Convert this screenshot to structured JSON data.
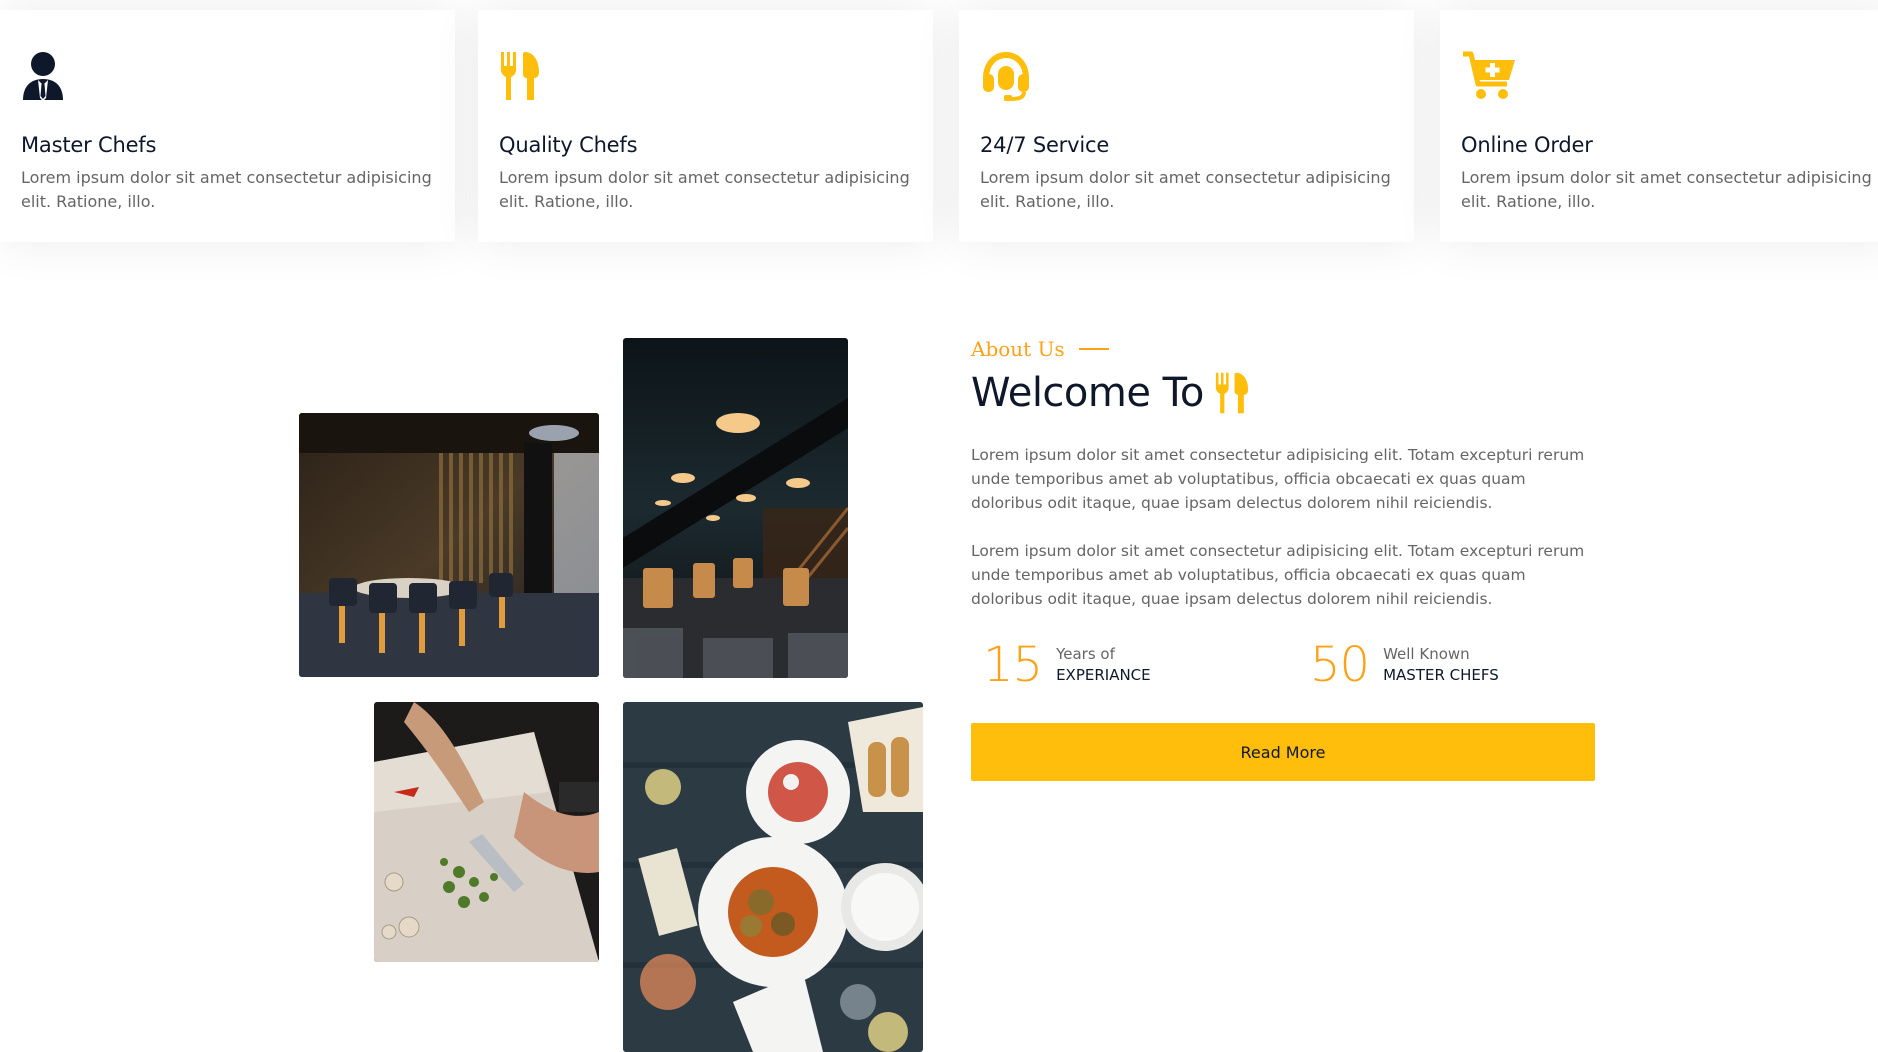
{
  "services": [
    {
      "icon": "user-tie-icon",
      "title": "Master Chefs",
      "text": "Lorem ipsum dolor sit amet consectetur adipisicing elit. Ratione, illo."
    },
    {
      "icon": "utensils-icon",
      "title": "Quality Chefs",
      "text": "Lorem ipsum dolor sit amet consectetur adipisicing elit. Ratione, illo."
    },
    {
      "icon": "headset-icon",
      "title": "24/7 Service",
      "text": "Lorem ipsum dolor sit amet consectetur adipisicing elit. Ratione, illo."
    },
    {
      "icon": "cart-plus-icon",
      "title": "Online Order",
      "text": "Lorem ipsum dolor sit amet consectetur adipisicing elit. Ratione, illo."
    }
  ],
  "about": {
    "label": "About Us",
    "heading": "Welcome To",
    "heading_icon": "utensils-icon",
    "paragraphs": [
      "Lorem ipsum dolor sit amet consectetur adipisicing elit. Totam excepturi rerum unde temporibus amet ab voluptatibus, officia obcaecati ex quas quam doloribus odit itaque, quae ipsam delectus dolorem nihil reiciendis.",
      "Lorem ipsum dolor sit amet consectetur adipisicing elit. Totam excepturi rerum unde temporibus amet ab voluptatibus, officia obcaecati ex quas quam doloribus odit itaque, quae ipsam delectus dolorem nihil reiciendis."
    ],
    "stats": [
      {
        "number": "15",
        "line1": "Years of",
        "line2": "EXPERIANCE"
      },
      {
        "number": "50",
        "line1": "Well Known",
        "line2": "MASTER CHEFS"
      }
    ],
    "button_label": "Read More",
    "photos": [
      "restaurant-interior-photo",
      "restaurant-dining-photo",
      "chef-chopping-photo",
      "food-table-photo"
    ]
  },
  "colors": {
    "accent": "#FEA116",
    "button": "#FEBE0B",
    "dark": "#0f172b",
    "body_text": "#666565"
  }
}
